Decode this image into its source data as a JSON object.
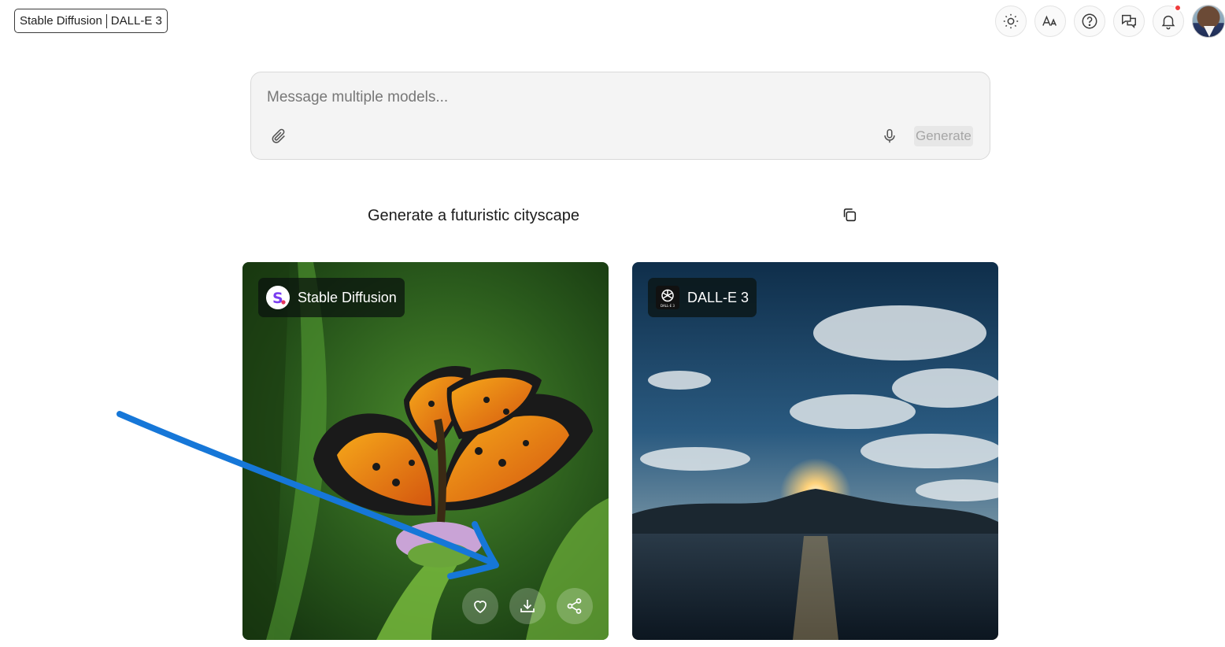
{
  "header": {
    "models_pill": {
      "left": "Stable Diffusion",
      "right": "DALL-E 3"
    },
    "icons": [
      "sun-icon",
      "text-size-icon",
      "help-icon",
      "chat-bubbles-icon",
      "bell-icon"
    ],
    "notification_dot_color": "#ef3b3b"
  },
  "composer": {
    "placeholder": "Message multiple models...",
    "generate_label": "Generate"
  },
  "prompt": {
    "text": "Generate a futuristic cityscape"
  },
  "cards": [
    {
      "model": "Stable Diffusion",
      "logo": "stable-diffusion-logo",
      "image": "butterfly on thistle flower",
      "actions": [
        "heart-icon",
        "download-icon",
        "share-icon"
      ]
    },
    {
      "model": "DALL-E 3",
      "logo": "openai-logo",
      "image": "sunset over lake with mountains and clouds"
    }
  ],
  "annotation": {
    "type": "arrow",
    "color": "#1677d8"
  }
}
